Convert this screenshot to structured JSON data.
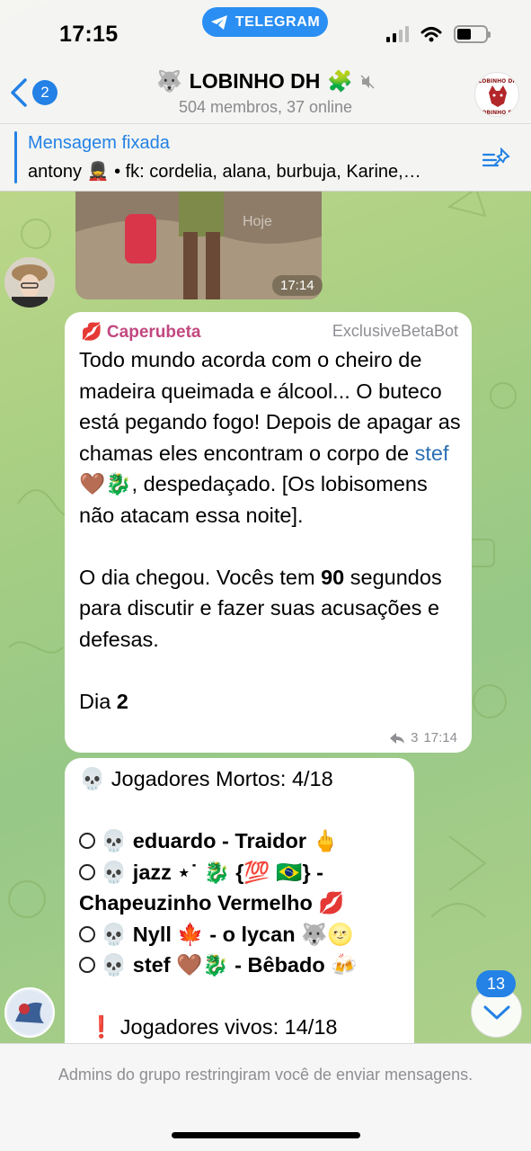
{
  "status_bar": {
    "time": "17:15",
    "app_pill": "TELEGRAM"
  },
  "header": {
    "back_count": "2",
    "title": "LOBINHO DH",
    "subtitle": "504 membros, 37 online",
    "avatar_text_top": "LOBINHO DH",
    "avatar_text_bottom": "LOBINHO DH"
  },
  "pinned": {
    "title": "Mensagem fixada",
    "text": "antony 💂 • fk: cordelia, alana, burbuja, Karine,…"
  },
  "media_message": {
    "time": "17:14",
    "watermark": "Hoje"
  },
  "message_1": {
    "sender": "💋 Caperubeta",
    "via": "ExclusiveBetaBot",
    "text_a": "Todo mundo acorda com o cheiro de madeira queimada e álcool... O buteco está pegando fogo! Depois de apagar as chamas eles encontram o corpo de ",
    "link": "stef",
    "text_b": " 🤎🐉, despedaçado. [Os lobisomens não atacam essa noite].",
    "para2_a": "O dia chegou. Vocês tem ",
    "para2_bold": "90",
    "para2_b": " segundos para discutir e fazer suas acusações e defesas.",
    "day_label": "Dia ",
    "day_num": "2",
    "forwards": "3",
    "time": "17:14"
  },
  "message_2": {
    "dead_header": "💀 Jogadores Mortos: 4/18",
    "dead": [
      {
        "name": "💀 eduardo",
        "role": " - Traidor 🖕"
      },
      {
        "name": "💀 jazz ⋆˙ 🐉 {💯 🇧🇷}",
        "role": " - Chapeuzinho Vermelho 💋"
      },
      {
        "name": "💀 Nyll 🍁",
        "role": " - o lycan 🐺🌝"
      },
      {
        "name": "💀 stef 🤎🐉",
        "role": " - Bêbado 🍻"
      }
    ],
    "alive_header": "❗ Jogadores vivos: 14/18"
  },
  "scroll": {
    "count": "13"
  },
  "footer": {
    "restrict_text": "Admins do grupo restringiram você de enviar mensagens."
  },
  "colors": {
    "accent": "#2481e5",
    "sender": "#c2487f",
    "link": "#2b6fb4"
  }
}
